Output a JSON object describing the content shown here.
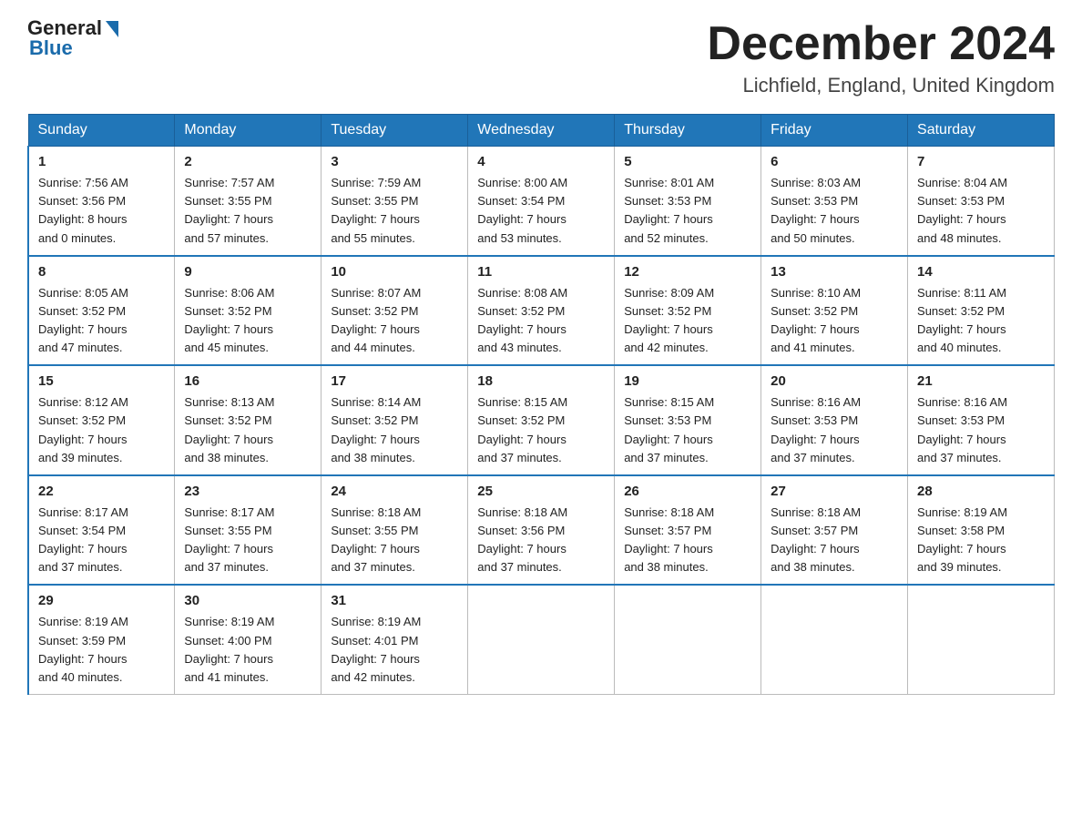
{
  "header": {
    "logo_general": "General",
    "logo_blue": "Blue",
    "month_title": "December 2024",
    "location": "Lichfield, England, United Kingdom"
  },
  "days_of_week": [
    "Sunday",
    "Monday",
    "Tuesday",
    "Wednesday",
    "Thursday",
    "Friday",
    "Saturday"
  ],
  "weeks": [
    [
      {
        "day": "1",
        "sunrise": "7:56 AM",
        "sunset": "3:56 PM",
        "daylight": "8 hours and 0 minutes."
      },
      {
        "day": "2",
        "sunrise": "7:57 AM",
        "sunset": "3:55 PM",
        "daylight": "7 hours and 57 minutes."
      },
      {
        "day": "3",
        "sunrise": "7:59 AM",
        "sunset": "3:55 PM",
        "daylight": "7 hours and 55 minutes."
      },
      {
        "day": "4",
        "sunrise": "8:00 AM",
        "sunset": "3:54 PM",
        "daylight": "7 hours and 53 minutes."
      },
      {
        "day": "5",
        "sunrise": "8:01 AM",
        "sunset": "3:53 PM",
        "daylight": "7 hours and 52 minutes."
      },
      {
        "day": "6",
        "sunrise": "8:03 AM",
        "sunset": "3:53 PM",
        "daylight": "7 hours and 50 minutes."
      },
      {
        "day": "7",
        "sunrise": "8:04 AM",
        "sunset": "3:53 PM",
        "daylight": "7 hours and 48 minutes."
      }
    ],
    [
      {
        "day": "8",
        "sunrise": "8:05 AM",
        "sunset": "3:52 PM",
        "daylight": "7 hours and 47 minutes."
      },
      {
        "day": "9",
        "sunrise": "8:06 AM",
        "sunset": "3:52 PM",
        "daylight": "7 hours and 45 minutes."
      },
      {
        "day": "10",
        "sunrise": "8:07 AM",
        "sunset": "3:52 PM",
        "daylight": "7 hours and 44 minutes."
      },
      {
        "day": "11",
        "sunrise": "8:08 AM",
        "sunset": "3:52 PM",
        "daylight": "7 hours and 43 minutes."
      },
      {
        "day": "12",
        "sunrise": "8:09 AM",
        "sunset": "3:52 PM",
        "daylight": "7 hours and 42 minutes."
      },
      {
        "day": "13",
        "sunrise": "8:10 AM",
        "sunset": "3:52 PM",
        "daylight": "7 hours and 41 minutes."
      },
      {
        "day": "14",
        "sunrise": "8:11 AM",
        "sunset": "3:52 PM",
        "daylight": "7 hours and 40 minutes."
      }
    ],
    [
      {
        "day": "15",
        "sunrise": "8:12 AM",
        "sunset": "3:52 PM",
        "daylight": "7 hours and 39 minutes."
      },
      {
        "day": "16",
        "sunrise": "8:13 AM",
        "sunset": "3:52 PM",
        "daylight": "7 hours and 38 minutes."
      },
      {
        "day": "17",
        "sunrise": "8:14 AM",
        "sunset": "3:52 PM",
        "daylight": "7 hours and 38 minutes."
      },
      {
        "day": "18",
        "sunrise": "8:15 AM",
        "sunset": "3:52 PM",
        "daylight": "7 hours and 37 minutes."
      },
      {
        "day": "19",
        "sunrise": "8:15 AM",
        "sunset": "3:53 PM",
        "daylight": "7 hours and 37 minutes."
      },
      {
        "day": "20",
        "sunrise": "8:16 AM",
        "sunset": "3:53 PM",
        "daylight": "7 hours and 37 minutes."
      },
      {
        "day": "21",
        "sunrise": "8:16 AM",
        "sunset": "3:53 PM",
        "daylight": "7 hours and 37 minutes."
      }
    ],
    [
      {
        "day": "22",
        "sunrise": "8:17 AM",
        "sunset": "3:54 PM",
        "daylight": "7 hours and 37 minutes."
      },
      {
        "day": "23",
        "sunrise": "8:17 AM",
        "sunset": "3:55 PM",
        "daylight": "7 hours and 37 minutes."
      },
      {
        "day": "24",
        "sunrise": "8:18 AM",
        "sunset": "3:55 PM",
        "daylight": "7 hours and 37 minutes."
      },
      {
        "day": "25",
        "sunrise": "8:18 AM",
        "sunset": "3:56 PM",
        "daylight": "7 hours and 37 minutes."
      },
      {
        "day": "26",
        "sunrise": "8:18 AM",
        "sunset": "3:57 PM",
        "daylight": "7 hours and 38 minutes."
      },
      {
        "day": "27",
        "sunrise": "8:18 AM",
        "sunset": "3:57 PM",
        "daylight": "7 hours and 38 minutes."
      },
      {
        "day": "28",
        "sunrise": "8:19 AM",
        "sunset": "3:58 PM",
        "daylight": "7 hours and 39 minutes."
      }
    ],
    [
      {
        "day": "29",
        "sunrise": "8:19 AM",
        "sunset": "3:59 PM",
        "daylight": "7 hours and 40 minutes."
      },
      {
        "day": "30",
        "sunrise": "8:19 AM",
        "sunset": "4:00 PM",
        "daylight": "7 hours and 41 minutes."
      },
      {
        "day": "31",
        "sunrise": "8:19 AM",
        "sunset": "4:01 PM",
        "daylight": "7 hours and 42 minutes."
      },
      null,
      null,
      null,
      null
    ]
  ],
  "labels": {
    "sunrise": "Sunrise:",
    "sunset": "Sunset:",
    "daylight": "Daylight:"
  }
}
